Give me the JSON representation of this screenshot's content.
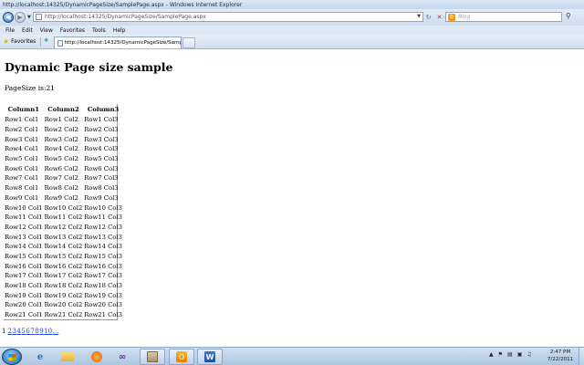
{
  "window": {
    "title": "http://localhost:14325/DynamicPageSize/SamplePage.aspx - Windows Internet Explorer"
  },
  "address_bar": {
    "url": "http://localhost:14325/DynamicPageSize/SamplePage.aspx"
  },
  "search": {
    "placeholder": "Bing"
  },
  "menu": {
    "items": [
      "File",
      "Edit",
      "View",
      "Favorites",
      "Tools",
      "Help"
    ]
  },
  "favorites_bar": {
    "favorites_label": "Favorites",
    "tab_title": "http://localhost:14325/DynamicPageSize/Sample..."
  },
  "page": {
    "heading": "Dynamic Page size sample",
    "page_size_text": "PageSize is:21",
    "grid": {
      "columns": [
        "Column1",
        "Column2",
        "Column3"
      ],
      "rows": [
        [
          "Row1 Col1",
          "Row1 Col2",
          "Row1 Col3"
        ],
        [
          "Row2 Col1",
          "Row2 Col2",
          "Row2 Col3"
        ],
        [
          "Row3 Col1",
          "Row3 Col2",
          "Row3 Col3"
        ],
        [
          "Row4 Col1",
          "Row4 Col2",
          "Row4 Col3"
        ],
        [
          "Row5 Col1",
          "Row5 Col2",
          "Row5 Col3"
        ],
        [
          "Row6 Col1",
          "Row6 Col2",
          "Row6 Col3"
        ],
        [
          "Row7 Col1",
          "Row7 Col2",
          "Row7 Col3"
        ],
        [
          "Row8 Col1",
          "Row8 Col2",
          "Row8 Col3"
        ],
        [
          "Row9 Col1",
          "Row9 Col2",
          "Row9 Col3"
        ],
        [
          "Row10 Col1",
          "Row10 Col2",
          "Row10 Col3"
        ],
        [
          "Row11 Col1",
          "Row11 Col2",
          "Row11 Col3"
        ],
        [
          "Row12 Col1",
          "Row12 Col2",
          "Row12 Col3"
        ],
        [
          "Row13 Col1",
          "Row13 Col2",
          "Row13 Col3"
        ],
        [
          "Row14 Col1",
          "Row14 Col2",
          "Row14 Col3"
        ],
        [
          "Row15 Col1",
          "Row15 Col2",
          "Row15 Col3"
        ],
        [
          "Row16 Col1",
          "Row16 Col2",
          "Row16 Col3"
        ],
        [
          "Row17 Col1",
          "Row17 Col2",
          "Row17 Col3"
        ],
        [
          "Row18 Col1",
          "Row18 Col2",
          "Row18 Col3"
        ],
        [
          "Row19 Col1",
          "Row19 Col2",
          "Row19 Col3"
        ],
        [
          "Row20 Col1",
          "Row20 Col2",
          "Row20 Col3"
        ],
        [
          "Row21 Col1",
          "Row21 Col2",
          "Row21 Col3"
        ]
      ]
    },
    "pager": {
      "current": "1",
      "links": [
        "2",
        "3",
        "4",
        "5",
        "6",
        "7",
        "8",
        "9",
        "10",
        "..."
      ]
    }
  },
  "taskbar": {
    "time": "2:47 PM",
    "date": "7/22/2011"
  },
  "icons": {
    "back": "back-arrow-icon",
    "forward": "forward-arrow-icon",
    "refresh": "refresh-icon",
    "stop": "stop-icon",
    "search": "search-icon",
    "favorites": "star-icon"
  },
  "colors": {
    "link": "#1a3dc8",
    "chrome": "#dbe8f6"
  }
}
